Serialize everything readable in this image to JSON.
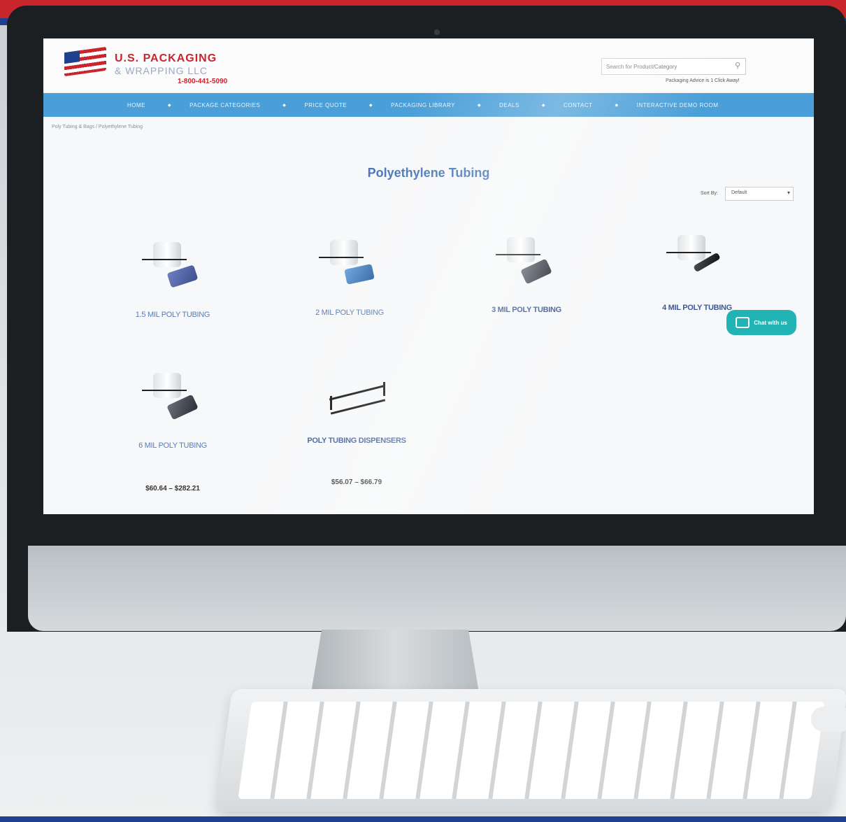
{
  "site": {
    "logo_line1": "U.S. PACKAGING",
    "logo_line2": "& WRAPPING LLC",
    "phone": "1-800-441-5090"
  },
  "search": {
    "placeholder": "Search for Product/Category",
    "advice_link": "Packaging Advice is 1 Click Away!"
  },
  "nav": {
    "items": [
      "HOME",
      "PACKAGE CATEGORIES",
      "PRICE QUOTE",
      "PACKAGING LIBRARY",
      "DEALS",
      "CONTACT",
      "INTERACTIVE DEMO ROOM"
    ],
    "separator": "◆"
  },
  "breadcrumb": "Poly Tubing & Bags / Polyethylene Tubing",
  "page_title": "Polyethylene Tubing",
  "sort": {
    "label": "Sort By:",
    "value": "Default",
    "caret": "▾"
  },
  "products": [
    {
      "label": "1.5 MIL POLY TUBING",
      "price": ""
    },
    {
      "label": "2 MIL POLY TUBING",
      "price": ""
    },
    {
      "label": "3 MIL POLY TUBING",
      "price": ""
    },
    {
      "label": "4 MIL POLY TUBING",
      "price": ""
    },
    {
      "label": "6 MIL POLY TUBING",
      "price": "$60.64 – $282.21"
    },
    {
      "label": "POLY TUBING DISPENSERS",
      "price": "$56.07 – $66.79"
    }
  ],
  "chat": {
    "label": "Chat with us"
  },
  "colors": {
    "nav_blue": "#4a9fd8",
    "brand_red": "#c8262c",
    "brand_blue": "#1f3f8f",
    "chat_teal": "#22b3b5",
    "title_blue": "#4a78b8"
  }
}
